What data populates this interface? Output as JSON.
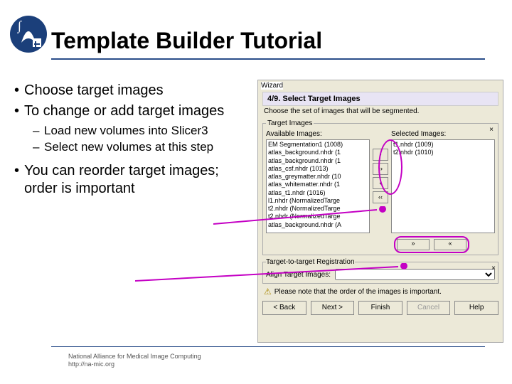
{
  "title": "Template Builder Tutorial",
  "bullets": {
    "b1": "Choose target images",
    "b2": "To change or add target images",
    "b2a": "Load new volumes into Slicer3",
    "b2b": "Select new volumes at this step",
    "b3": "You can reorder target images; order is important"
  },
  "footer": {
    "line1": "National Alliance for Medical Image Computing",
    "line2": "http://na-mic.org"
  },
  "wizard": {
    "window_title": "Wizard",
    "step_label": "4/9. Select Target Images",
    "step_desc": "Choose the set of images that will be segmented.",
    "target_legend": "Target Images",
    "avail_label": "Available Images:",
    "sel_label": "Selected Images:",
    "available": [
      "EM Segmentation1 (1008)",
      "atlas_background.nhdr (1",
      "atlas_background.nhdr (1",
      "atlas_csf.nhdr (1013)",
      "atlas_greymatter.nhdr (10",
      "atlas_whitematter.nhdr (1",
      "atlas_t1.nhdr (1016)",
      "l1.nhdr (NormalizedTarge",
      "t2.nhdr (NormalizedTarge",
      "t2.nhdr (NormalizedTarge",
      "atlas_background.nhdr (A"
    ],
    "selected": [
      "t1.nhdr (1009)",
      "t2.nhdr (1010)"
    ],
    "btn_add": "›",
    "btn_add_all": "››",
    "btn_rem": "‹",
    "btn_rem_all": "‹‹",
    "move_up": "»",
    "move_dn": "«",
    "reg_legend": "Target-to-target Registration",
    "align_label": "Align Target Images:",
    "note": "Please note that the order of the images is important.",
    "buttons": {
      "back": "< Back",
      "next": "Next >",
      "finish": "Finish",
      "cancel": "Cancel",
      "help": "Help"
    }
  }
}
